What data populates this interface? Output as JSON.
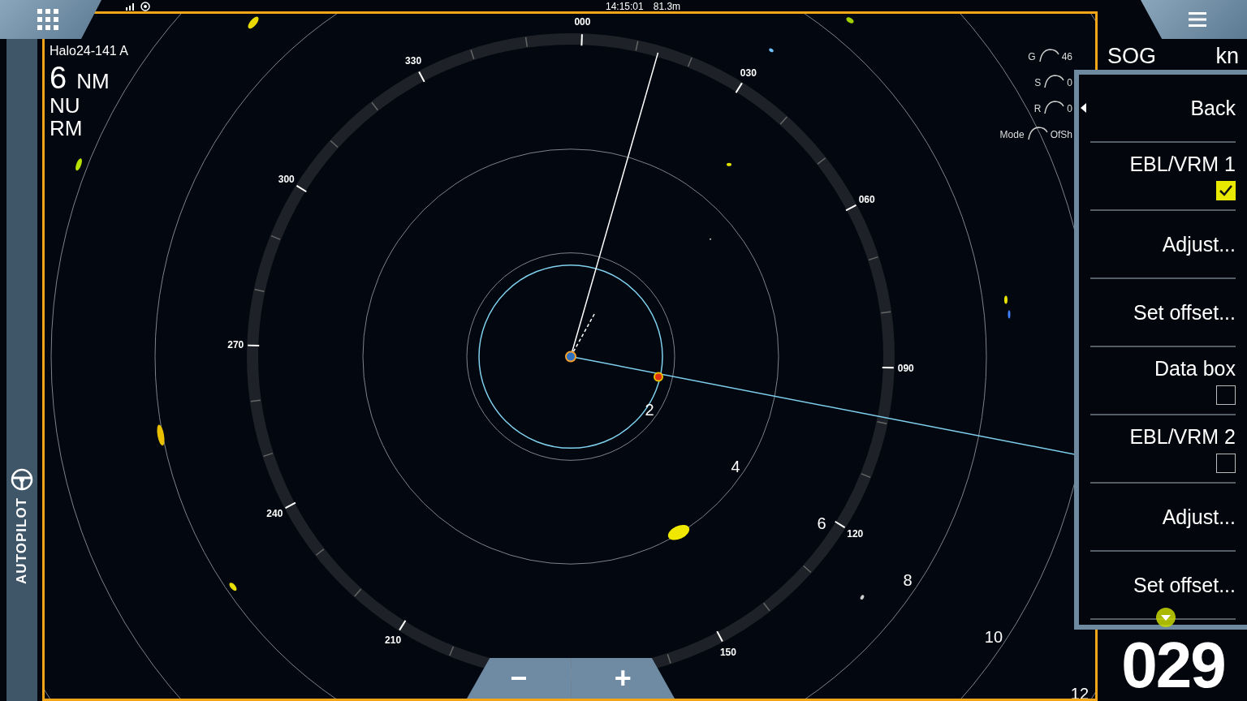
{
  "status_bar": {
    "time": "14:15:01",
    "depth": "81.3m"
  },
  "sidebar": {
    "tab": "AUTOPILOT"
  },
  "radar": {
    "source": "Halo24-141 A",
    "range_value": "6",
    "range_unit": "NM",
    "orientation": "NU",
    "motion": "RM",
    "bearing_labels": [
      "000",
      "030",
      "060",
      "090",
      "120",
      "150",
      "210",
      "240",
      "270",
      "300",
      "330"
    ],
    "range_labels": [
      "2",
      "4",
      "6",
      "8",
      "10",
      "12"
    ],
    "gauges": [
      {
        "label": "G",
        "value": "46"
      },
      {
        "label": "S",
        "value": "0"
      },
      {
        "label": "R",
        "value": "0"
      },
      {
        "label": "Mode",
        "value": "OfSh"
      }
    ],
    "zoom_buttons": [
      "−",
      "+"
    ]
  },
  "data_panel": {
    "label": "SOG",
    "unit": "kn",
    "value": "029"
  },
  "menu": {
    "items": [
      {
        "kind": "back",
        "label": "Back"
      },
      {
        "kind": "checkbox",
        "label": "EBL/VRM 1",
        "checked": true
      },
      {
        "kind": "action",
        "label": "Adjust..."
      },
      {
        "kind": "action",
        "label": "Set offset..."
      },
      {
        "kind": "checkbox",
        "label": "Data box",
        "checked": false
      },
      {
        "kind": "checkbox",
        "label": "EBL/VRM 2",
        "checked": false
      },
      {
        "kind": "action",
        "label": "Adjust..."
      },
      {
        "kind": "action",
        "label": "Set offset..."
      }
    ]
  }
}
